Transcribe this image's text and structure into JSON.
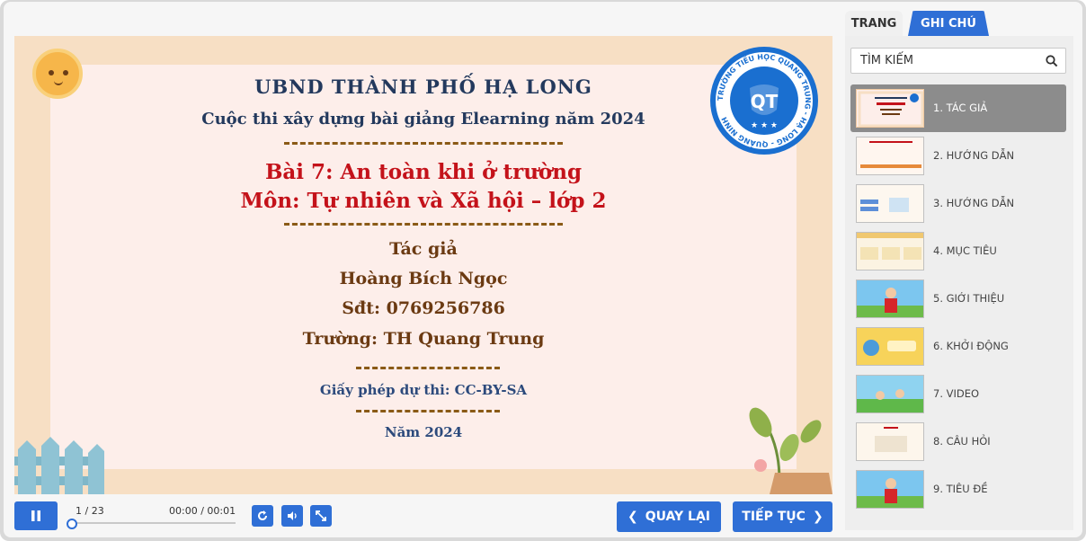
{
  "slide": {
    "line1": "UBND THÀNH PHỐ HẠ LONG",
    "line2": "Cuộc thi xây dựng bài giảng Elearning năm 2024",
    "lesson": "Bài 7: An toàn khi ở trường",
    "subject": "Môn: Tự nhiên và Xã hội – lớp 2",
    "author_label": "Tác giả",
    "author_name": "Hoàng Bích Ngọc",
    "phone": "Sđt: 0769256786",
    "school": "Trường: TH Quang Trung",
    "license": "Giấy phép dự thi: CC-BY-SA",
    "year": "Năm 2024",
    "seal_ring": "TRƯỜNG TIỂU HỌC QUANG TRUNG - HẠ LONG - QUẢNG NINH",
    "seal_logo": "QT"
  },
  "controls": {
    "page": "1 / 23",
    "time": "00:00  / 00:01",
    "progress": 0,
    "back_label": "QUAY LẠI",
    "next_label": "TIẾP TỤC"
  },
  "sidebar": {
    "tabs": [
      "TRANG",
      "GHI CHÚ"
    ],
    "search_placeholder": "TÌM KIẾM",
    "items": [
      {
        "label": "1. TÁC GIẢ",
        "active": true
      },
      {
        "label": "2. HƯỚNG DẪN"
      },
      {
        "label": "3. HƯỚNG DẪN"
      },
      {
        "label": "4. MỤC TIÊU"
      },
      {
        "label": "5. GIỚI THIỆU"
      },
      {
        "label": "6. KHỞI ĐỘNG"
      },
      {
        "label": "7. VIDEO"
      },
      {
        "label": "8. CÂU HỎI"
      },
      {
        "label": "9. TIÊU ĐỀ"
      }
    ]
  },
  "colors": {
    "accent": "#2f6fd6",
    "title_red": "#c4121a",
    "brown": "#6b3a12",
    "navy": "#23395d"
  }
}
